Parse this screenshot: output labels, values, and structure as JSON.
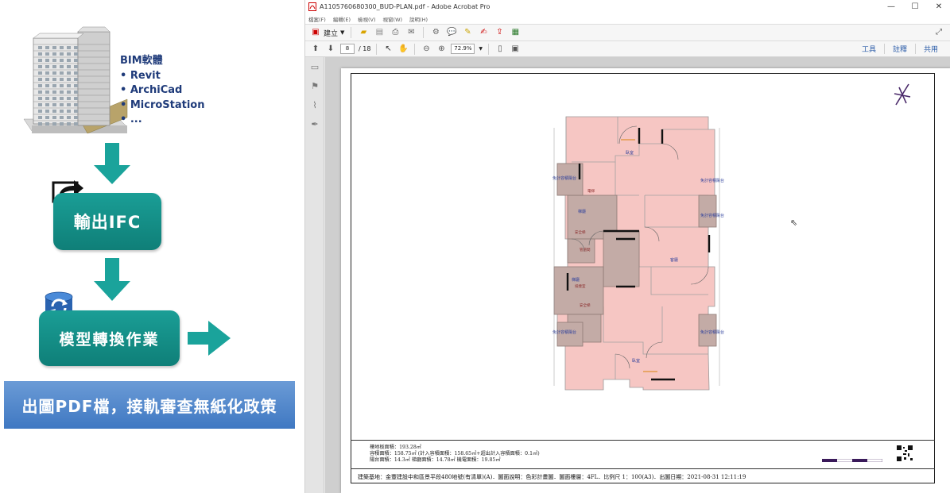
{
  "diagram": {
    "bim_title": "BIM軟體",
    "bim_items": [
      "Revit",
      "ArchiCad",
      "MicroStation",
      "..."
    ],
    "export_box": "輸出IFC",
    "convert_box": "模型轉換作業",
    "policy_banner": "出圖PDF檔，接軌審查無紙化政策",
    "colors": {
      "teal_box": "#13928a",
      "arrow": "#1aa39b",
      "banner": "#4f86c9"
    }
  },
  "acrobat": {
    "window_title": "A1105760680300_BUD-PLAN.pdf - Adobe Acrobat Pro",
    "menu": [
      "檔案(F)",
      "編輯(E)",
      "檢視(V)",
      "視窗(W)",
      "說明(H)"
    ],
    "create_label": "建立",
    "page_current": "8",
    "page_total": "/ 18",
    "zoom": "72.9%",
    "right_tabs": [
      "工具",
      "註釋",
      "共用"
    ],
    "icons": [
      "save-icon",
      "print-icon",
      "email-icon",
      "settings-icon",
      "comment-icon"
    ]
  },
  "plan": {
    "info_lines": [
      "樓地板面積：193.28㎡",
      "容積面積：158.75㎡ (計入容積面積：158.65㎡+超出計入容積面積：0.1㎡)",
      "陽台面積：14.3㎡         梯廳面積：14.78㎡         機電面積：19.85㎡"
    ],
    "address": "建築基地：金豐建設中和區景平段480地號(有清單)(A)．圖面說明：色彩計畫圖．圖面樓層：4FL．比例尺 1：100(A3)．出圖日期：2021-08-31 12:11:19"
  }
}
